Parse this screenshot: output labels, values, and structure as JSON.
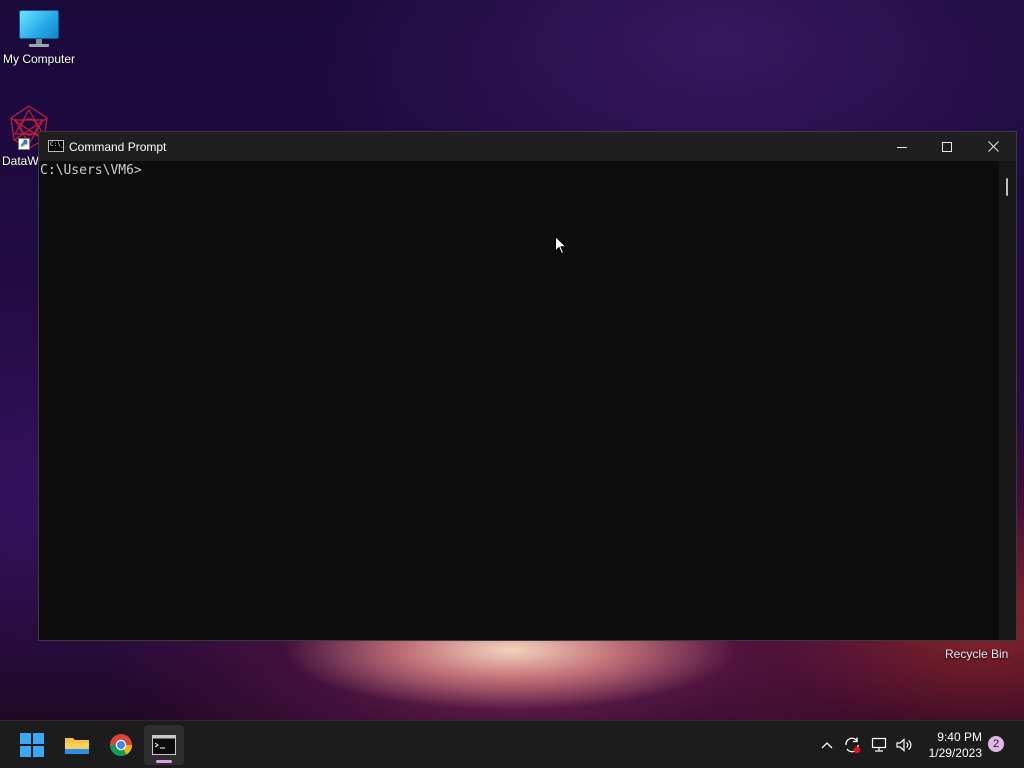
{
  "desktop": {
    "icons": [
      {
        "label": "My Computer"
      },
      {
        "label": "DataW"
      }
    ],
    "recycle_bin_label": "Recycle Bin"
  },
  "window": {
    "title": "Command Prompt",
    "app_icon_text": "C:\\_",
    "console_lines": [
      "C:\\Users\\VM6>"
    ]
  },
  "taskbar": {
    "apps": [
      "start",
      "file-explorer",
      "chrome",
      "command-prompt"
    ],
    "active_app": "command-prompt",
    "clock_time": "9:40 PM",
    "clock_date": "1/29/2023",
    "notification_count": "2"
  },
  "colors": {
    "console_bg": "#0c0c0c",
    "titlebar_bg": "#1f1f1f",
    "taskbar_bg": "#1c1c1c",
    "accent": "#d8a0e6"
  }
}
